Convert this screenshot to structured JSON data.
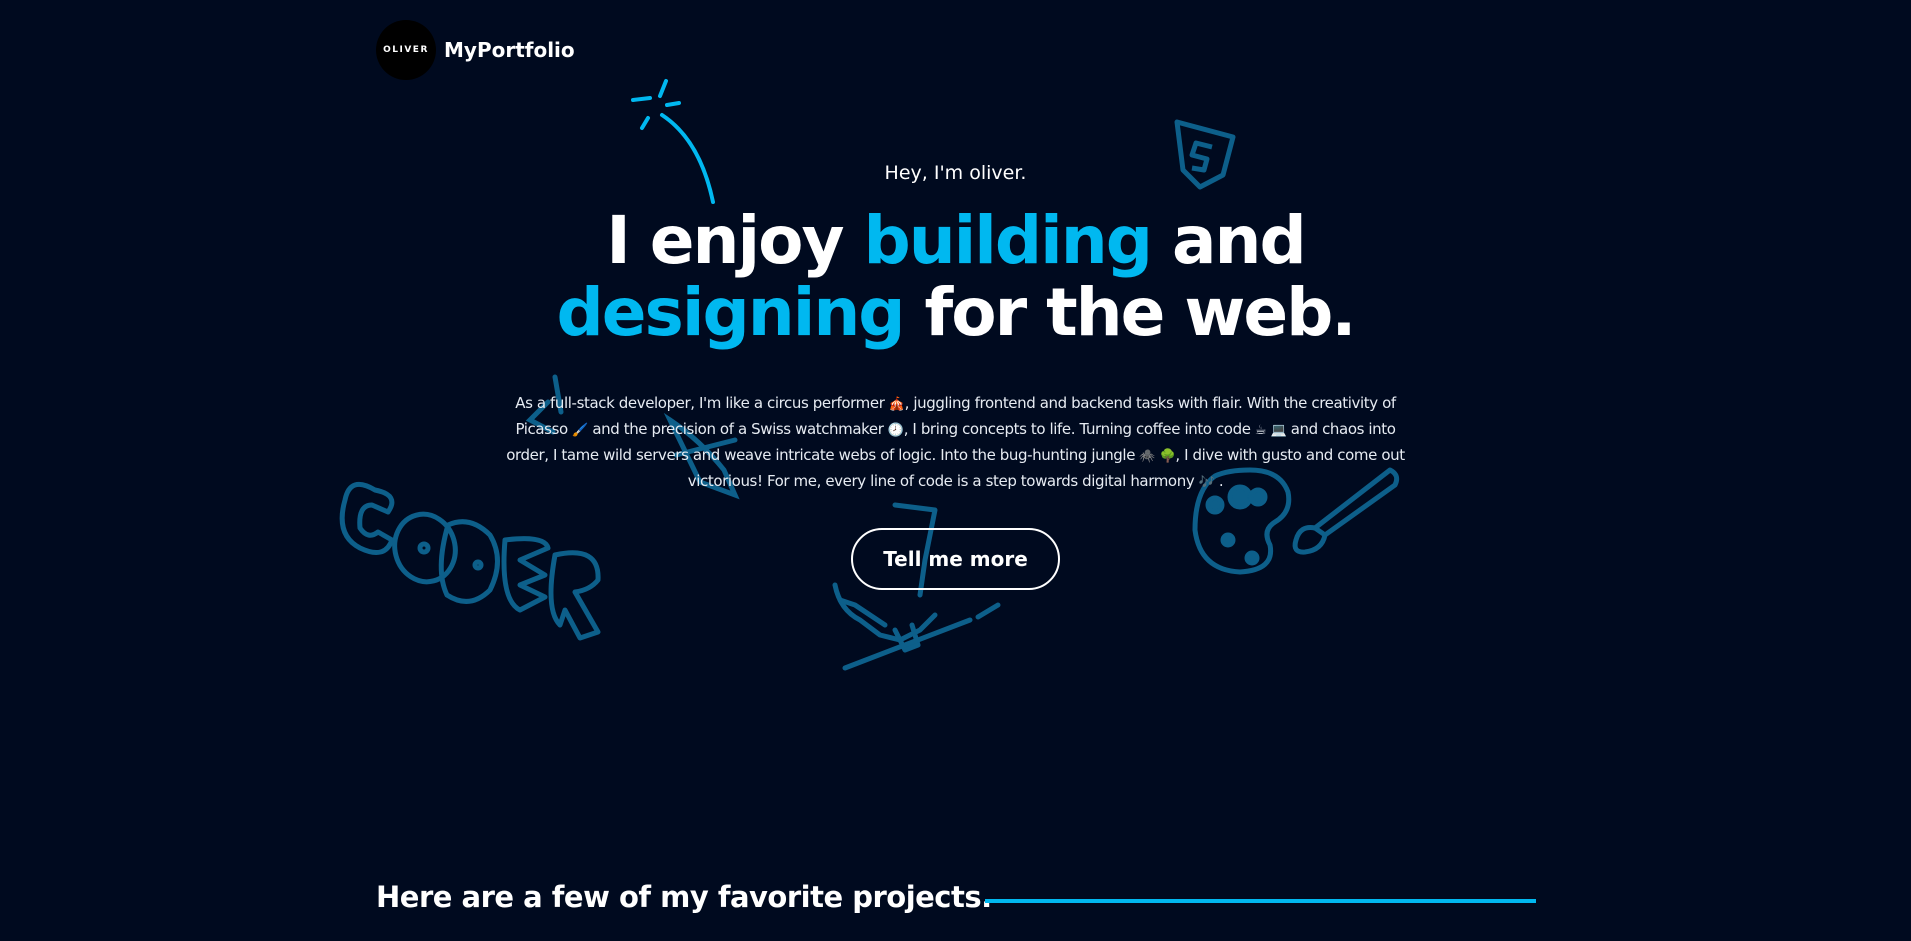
{
  "header": {
    "logo_text": "OLIVER",
    "brand_name": "MyPortfolio"
  },
  "hero": {
    "greeting": "Hey, I'm oliver.",
    "headline": {
      "part1": "I enjoy ",
      "accent1": "building",
      "part2": " and",
      "accent2": "designing",
      "part3": " for the web."
    },
    "intro": {
      "s1": "As a full-stack developer, I'm like a circus performer ",
      "e1": "🎪",
      "s2": ", juggling frontend and backend tasks with flair. With the creativity of Picasso ",
      "e2": "🖌️",
      "s3": " and the precision of a Swiss watchmaker ",
      "e3": "🕗",
      "s4": ", I bring concepts to life. Turning coffee into code ",
      "e4": "☕",
      "e5": "💻",
      "s5": " and chaos into order, I tame wild servers and weave intricate webs of logic. Into the bug-hunting jungle ",
      "e6": "🕷️",
      "e7": "🌳",
      "s6": ", I dive with gusto and come out victorious! For me, every line of code is a step towards digital harmony ",
      "e8": "🎶",
      "s7": "."
    },
    "cta_label": "Tell me more"
  },
  "projects": {
    "heading": "Here are a few of my favorite projects."
  },
  "colors": {
    "background": "#000a1f",
    "accent": "#00b8f0",
    "doodle": "#0d5f8a",
    "text": "#ffffff"
  }
}
